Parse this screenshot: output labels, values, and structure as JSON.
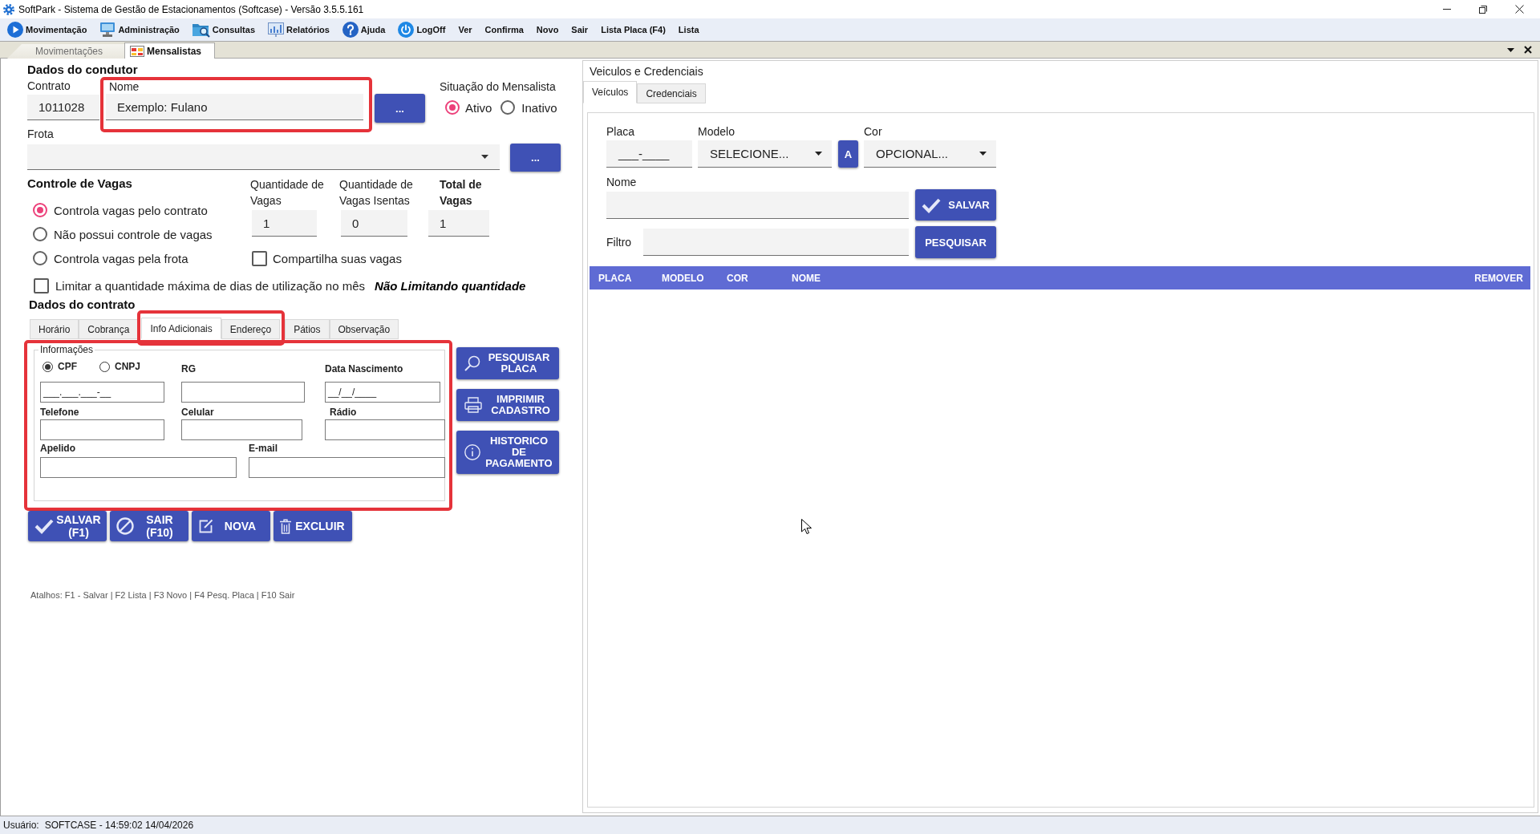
{
  "window": {
    "title": "SoftPark - Sistema de Gestão de Estacionamentos (Softcase) - Versão 3.5.5.161"
  },
  "menu": [
    {
      "label": "Movimentação"
    },
    {
      "label": "Administração"
    },
    {
      "label": "Consultas"
    },
    {
      "label": "Relatórios"
    },
    {
      "label": "Ajuda"
    },
    {
      "label": "LogOff"
    },
    {
      "label": "Ver"
    },
    {
      "label": "Confirma"
    },
    {
      "label": "Novo"
    },
    {
      "label": "Sair"
    },
    {
      "label": "Lista Placa (F4)"
    },
    {
      "label": "Lista"
    }
  ],
  "document_tabs": [
    {
      "label": "Movimentações",
      "selected": false
    },
    {
      "label": "Mensalistas",
      "selected": true
    }
  ],
  "driver": {
    "heading": "Dados do condutor",
    "contrato": {
      "label": "Contrato",
      "value": "1011028"
    },
    "nome": {
      "label": "Nome",
      "value": "Exemplo: Fulano",
      "highlighted": true
    },
    "nome_button": "...",
    "situacao": {
      "label": "Situação do Mensalista",
      "options": [
        {
          "label": "Ativo",
          "selected": true
        },
        {
          "label": "Inativo",
          "selected": false
        }
      ]
    },
    "frota": {
      "label": "Frota",
      "button": "..."
    }
  },
  "vagas": {
    "heading": "Controle de Vagas",
    "options": [
      {
        "label": "Controla vagas pelo contrato",
        "selected": true
      },
      {
        "label": "Não possui controle de vagas",
        "selected": false
      },
      {
        "label": "Controla vagas pela frota",
        "selected": false
      }
    ],
    "quantities": [
      {
        "label": "Quantidade de Vagas",
        "value": "1",
        "kind": "count"
      },
      {
        "label": "Quantidade de Vagas Isentas",
        "value": "0",
        "kind": "count"
      },
      {
        "label": "Total de Vagas",
        "value": "1",
        "kind": "total"
      }
    ],
    "share": {
      "label": "Compartilha suas vagas",
      "checked": false
    },
    "limit": {
      "label": "Limitar a quantidade máxima de dias de utilização no mês",
      "checked": false,
      "status": "Não Limitando quantidade"
    }
  },
  "contract": {
    "heading": "Dados do contrato",
    "tabs": [
      {
        "label": "Horário",
        "selected": false,
        "highlighted": false
      },
      {
        "label": "Cobrança",
        "selected": false,
        "highlighted": false
      },
      {
        "label": "Info Adicionais",
        "selected": true,
        "highlighted": true
      },
      {
        "label": "Endereço",
        "selected": false,
        "highlighted": true
      },
      {
        "label": "Pátios",
        "selected": false,
        "highlighted": false
      },
      {
        "label": "Observação",
        "selected": false,
        "highlighted": false
      }
    ],
    "panel": {
      "highlighted": true,
      "group": "Informações",
      "document_types": [
        {
          "label": "CPF",
          "selected": true
        },
        {
          "label": "CNPJ",
          "selected": false
        }
      ],
      "document_number": {
        "value": "___.___.___-__"
      },
      "rg": {
        "label": "RG"
      },
      "birth_date": {
        "label": "Data Nascimento",
        "value": "__/__/____"
      },
      "telefone": {
        "label": "Telefone"
      },
      "celular": {
        "label": "Celular"
      },
      "radio": {
        "label": "Rádio"
      },
      "apelido": {
        "label": "Apelido"
      },
      "email": {
        "label": "E-mail"
      }
    },
    "side_buttons": [
      "PESQUISAR PLACA",
      "IMPRIMIR CADASTRO",
      "HISTORICO DE PAGAMENTO"
    ],
    "actions": [
      "SALVAR (F1)",
      "SAIR (F10)",
      "NOVA",
      "EXCLUIR"
    ],
    "shortcuts": "Atalhos: F1 - Salvar | F2 Lista | F3 Novo | F4 Pesq. Placa | F10 Sair"
  },
  "vehicles": {
    "title": "Veiculos e Credenciais",
    "tabs": [
      {
        "label": "Veículos",
        "selected": true
      },
      {
        "label": "Credenciais",
        "selected": false
      }
    ],
    "placa": {
      "label": "Placa",
      "value": "___-____"
    },
    "modelo": {
      "label": "Modelo",
      "value": "SELECIONE..."
    },
    "add_button": "A",
    "cor": {
      "label": "Cor",
      "value": "OPCIONAL..."
    },
    "nome": {
      "label": "Nome"
    },
    "save_button": "SALVAR",
    "filtro": {
      "label": "Filtro"
    },
    "search_button": "PESQUISAR",
    "table": {
      "columns": [
        "PLACA",
        "MODELO",
        "COR",
        "NOME",
        "REMOVER"
      ]
    }
  },
  "status_bar": {
    "label": "Usuário:",
    "text": "SOFTCASE - 14:59:02 14/04/2026"
  }
}
